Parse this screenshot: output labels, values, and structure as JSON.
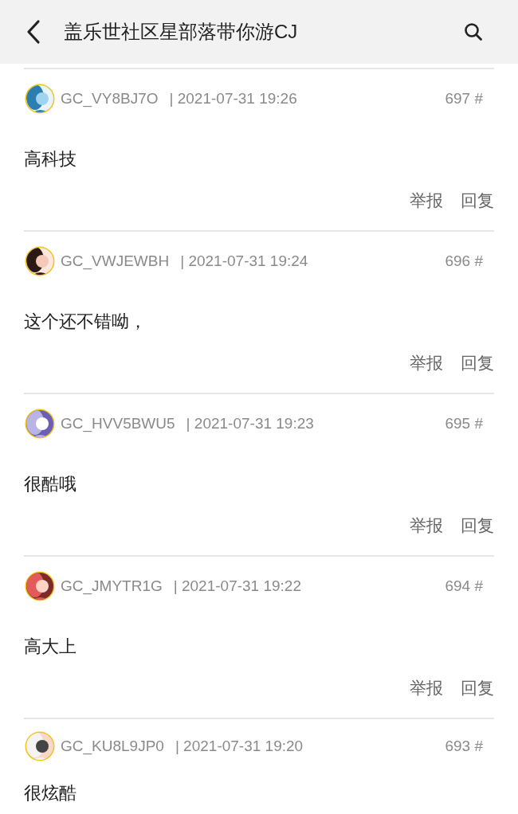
{
  "header": {
    "title": "盖乐世社区星部落带你游CJ"
  },
  "posts": [
    {
      "user": "GC_VY8BJ7O",
      "time": "| 2021-07-31 19:26",
      "floor": "697 #",
      "text": "高科技",
      "actions": [
        "举报",
        "回复"
      ]
    },
    {
      "user": "GC_VWJEWBH",
      "time": "| 2021-07-31 19:24",
      "floor": "696 #",
      "text": "这个还不错呦，",
      "actions": [
        "举报",
        "回复"
      ]
    },
    {
      "user": "GC_HVV5BWU5",
      "time": "| 2021-07-31 19:23",
      "floor": "695 #",
      "text": "很酷哦",
      "actions": [
        "举报",
        "回复"
      ]
    },
    {
      "user": "GC_JMYTR1G",
      "time": "| 2021-07-31 19:22",
      "floor": "694 #",
      "text": "高大上",
      "actions": [
        "举报",
        "回复"
      ]
    },
    {
      "user": "GC_KU8L9JP0",
      "time": "| 2021-07-31 19:20",
      "floor": "693 #",
      "text": "很炫酷"
    }
  ]
}
